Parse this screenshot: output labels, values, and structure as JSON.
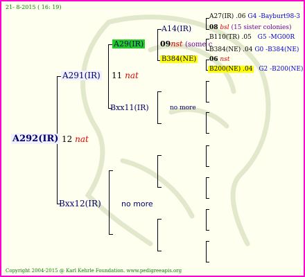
{
  "header": {
    "date": "21- 8-2015 ( 16: 19)"
  },
  "root": {
    "name": "A292(IR)",
    "number": "12",
    "tag": "nat"
  },
  "gen1": [
    {
      "name": "A291(IR)",
      "number": "11",
      "tag": "nat"
    },
    {
      "name": "Bxx12(IR)",
      "note": "no more"
    }
  ],
  "gen2": [
    {
      "name": "A29(IR)",
      "number": "09",
      "tag": "nst",
      "extra": "(some c"
    },
    {
      "name": "Bxx11(IR)",
      "note": "no more"
    }
  ],
  "gen3": [
    {
      "name": "A14(IR)"
    },
    {
      "name": "B384(NE)"
    }
  ],
  "gen4": [
    {
      "name": "A27(IR)",
      "val": ".06",
      "info": "G4 -Bayburt98-3"
    },
    {
      "name": "08",
      "tag": "bsl",
      "info": "(15 sister colonies)"
    },
    {
      "name": "B110(TR)",
      "val": ".05",
      "info": "G5 -MG00R"
    },
    {
      "name": "B384(NE)",
      "val": ".04",
      "info": "G0 -B384(NE)"
    },
    {
      "name": "06",
      "tag": "nst"
    },
    {
      "name": "B200(NE)",
      "val": ".04",
      "info": "G2 -B200(NE)"
    }
  ],
  "footer": {
    "copyright": "Copyright 2004-2015 @ Karl Kehrle Foundation.   www.pedigreeapis.org"
  }
}
